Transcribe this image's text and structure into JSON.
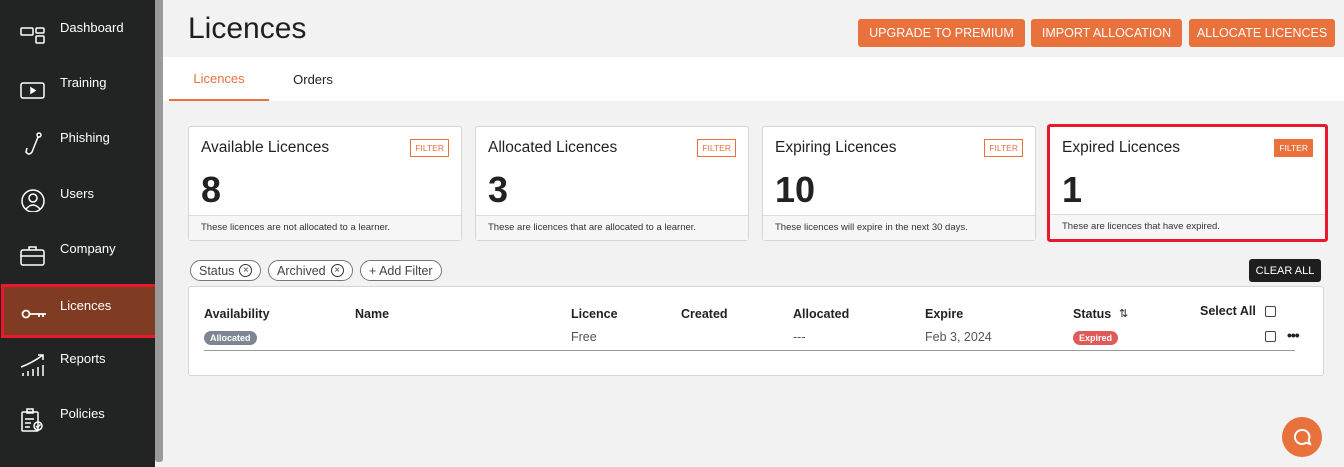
{
  "sidebar": {
    "items": [
      {
        "label": "Dashboard",
        "icon": "dashboard-icon"
      },
      {
        "label": "Training",
        "icon": "play-icon"
      },
      {
        "label": "Phishing",
        "icon": "hook-icon"
      },
      {
        "label": "Users",
        "icon": "user-icon"
      },
      {
        "label": "Company",
        "icon": "briefcase-icon"
      },
      {
        "label": "Licences",
        "icon": "key-icon",
        "active": true
      },
      {
        "label": "Reports",
        "icon": "chart-icon"
      },
      {
        "label": "Policies",
        "icon": "clipboard-icon"
      }
    ]
  },
  "header": {
    "title": "Licences",
    "buttons": [
      "UPGRADE TO PREMIUM",
      "IMPORT ALLOCATION",
      "ALLOCATE LICENCES"
    ]
  },
  "tabs": [
    "Licences",
    "Orders"
  ],
  "cards": [
    {
      "title": "Available Licences",
      "filter": "FILTER",
      "count": "8",
      "desc": "These licences are not allocated to a learner."
    },
    {
      "title": "Allocated Licences",
      "filter": "FILTER",
      "count": "3",
      "desc": "These are licences that are allocated to a learner."
    },
    {
      "title": "Expiring Licences",
      "filter": "FILTER",
      "count": "10",
      "desc": "These licences will expire in the next 30 days."
    },
    {
      "title": "Expired Licences",
      "filter": "FILTER",
      "count": "1",
      "desc": "These are licences that have expired."
    }
  ],
  "filters": {
    "pills": [
      "Status",
      "Archived"
    ],
    "add": "+ Add Filter",
    "clear": "CLEAR ALL"
  },
  "table": {
    "headers": [
      "Availability",
      "Name",
      "Licence",
      "Created",
      "Allocated",
      "Expire",
      "Status",
      "Select All"
    ],
    "rows": [
      {
        "availability": "Allocated",
        "name": "",
        "licence": "Free",
        "created": "",
        "allocated": "---",
        "expire": "Feb 3, 2024",
        "status": "Expired"
      }
    ]
  },
  "colors": {
    "accent": "#e8713c",
    "sidebar": "#222424",
    "expired": "#e05a5a",
    "allocated": "#7d8794"
  }
}
